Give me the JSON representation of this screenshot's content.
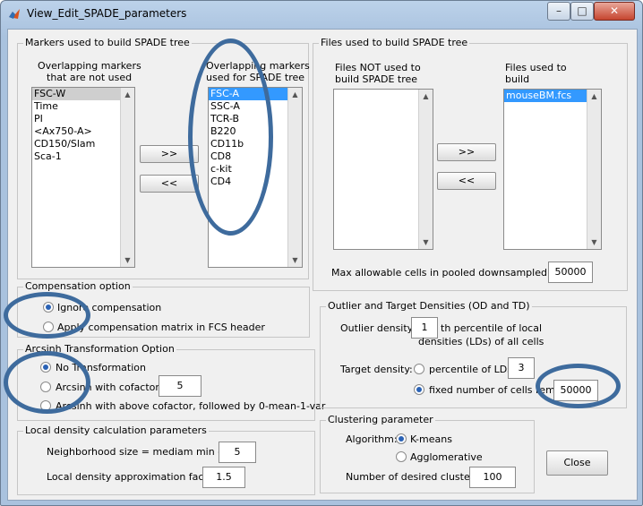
{
  "window": {
    "title": "View_Edit_SPADE_parameters"
  },
  "markers": {
    "group_label": "Markers used to build SPADE tree",
    "not_used_header_1": "Overlapping markers",
    "not_used_header_2": "that are not used",
    "used_header_1": "Overlapping markers",
    "used_header_2": "used for SPADE tree",
    "not_used": [
      "FSC-W",
      "Time",
      "PI",
      "<Ax750-A>",
      "CD150/Slam",
      "Sca-1"
    ],
    "used": [
      "FSC-A",
      "SSC-A",
      "TCR-B",
      "B220",
      "CD11b",
      "CD8",
      "c-kit",
      "CD4"
    ],
    "add_label": ">>",
    "remove_label": "<<"
  },
  "files": {
    "group_label": "Files used to build SPADE tree",
    "not_used_header_1": "Files NOT used to",
    "not_used_header_2": "build SPADE tree",
    "used_header_1": "Files used to",
    "used_header_2": "build",
    "used": [
      "mouseBM.fcs"
    ],
    "add_label": ">>",
    "remove_label": "<<",
    "max_cells_label": "Max allowable cells in pooled downsampled data:",
    "max_cells_value": "50000"
  },
  "compensation": {
    "group_label": "Compensation option",
    "option1": "Ignore compensation",
    "option2": "Apply compensation matrix in FCS header",
    "selected": "option1"
  },
  "arcsinh": {
    "group_label": "Arcsinh Transformation Option",
    "option1": "No Transformation",
    "option2": "Arcsinh with cofactor",
    "option3": "Arcsinh with above cofactor, followed by 0-mean-1-var",
    "cofactor": "5",
    "selected": "option1"
  },
  "local_density": {
    "group_label": "Local density calculation parameters",
    "neighborhood_label": "Neighborhood size = mediam min dist *",
    "neighborhood_value": "5",
    "approx_label": "Local density approximation factor:",
    "approx_value": "1.5"
  },
  "densities": {
    "group_label": "Outlier and Target Densities (OD and TD)",
    "outlier_label": "Outlier density:",
    "outlier_value": "1",
    "outlier_suffix_1": "th percentile of local",
    "outlier_suffix_2": "densities (LDs) of all cells",
    "target_label": "Target density:",
    "target_option1": "percentile of LDs",
    "target_option1_value": "3",
    "target_option2": "fixed number of cells remain",
    "target_option2_value": "50000",
    "selected": "option2"
  },
  "clustering": {
    "group_label": "Clustering parameter",
    "algorithm_label": "Algorithm:",
    "option1": "K-means",
    "option2": "Agglomerative",
    "selected": "option1",
    "clusters_label": "Number of desired clusters:",
    "clusters_value": "100"
  },
  "close_label": "Close",
  "colors": {
    "highlight_ring": "#3e6b9d",
    "selection_blue": "#3399ff"
  }
}
